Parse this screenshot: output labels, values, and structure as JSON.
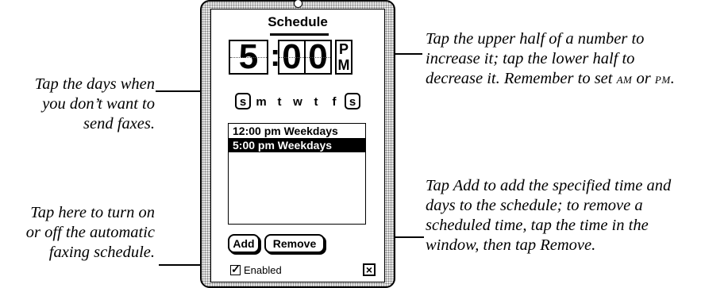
{
  "device": {
    "title": "Schedule",
    "time": {
      "hour": "5",
      "colon": ":",
      "minute_tens": "0",
      "minute_ones": "0",
      "am_pm_top": "P",
      "am_pm_bottom": "M"
    },
    "days": [
      {
        "letter": "s",
        "excluded": true
      },
      {
        "letter": "m",
        "excluded": false
      },
      {
        "letter": "t",
        "excluded": false
      },
      {
        "letter": "w",
        "excluded": false
      },
      {
        "letter": "t",
        "excluded": false
      },
      {
        "letter": "f",
        "excluded": false
      },
      {
        "letter": "s",
        "excluded": true
      }
    ],
    "schedule_list": [
      {
        "text": "12:00 pm Weekdays",
        "selected": false
      },
      {
        "text": "5:00 pm Weekdays",
        "selected": true
      }
    ],
    "add_label": "Add",
    "remove_label": "Remove",
    "enabled_label": "Enabled",
    "enabled_checked": true,
    "close_glyph": "×"
  },
  "callouts": {
    "days": [
      "Tap the days when",
      "you don’t want to",
      "send faxes."
    ],
    "enabled": [
      "Tap here to turn on",
      "or off the automatic",
      "faxing schedule."
    ],
    "time_1": "Tap the upper half of a number to",
    "time_2": "increase it; tap the lower half to",
    "time_3a": "decrease it. Remember to set ",
    "time_am": "AM",
    "time_or": " or ",
    "time_pm": "PM",
    "time_end": ".",
    "add": [
      "Tap Add to add the specified time and",
      "days to the schedule; to remove a",
      "scheduled time, tap the time in the",
      "window, then tap Remove."
    ]
  }
}
